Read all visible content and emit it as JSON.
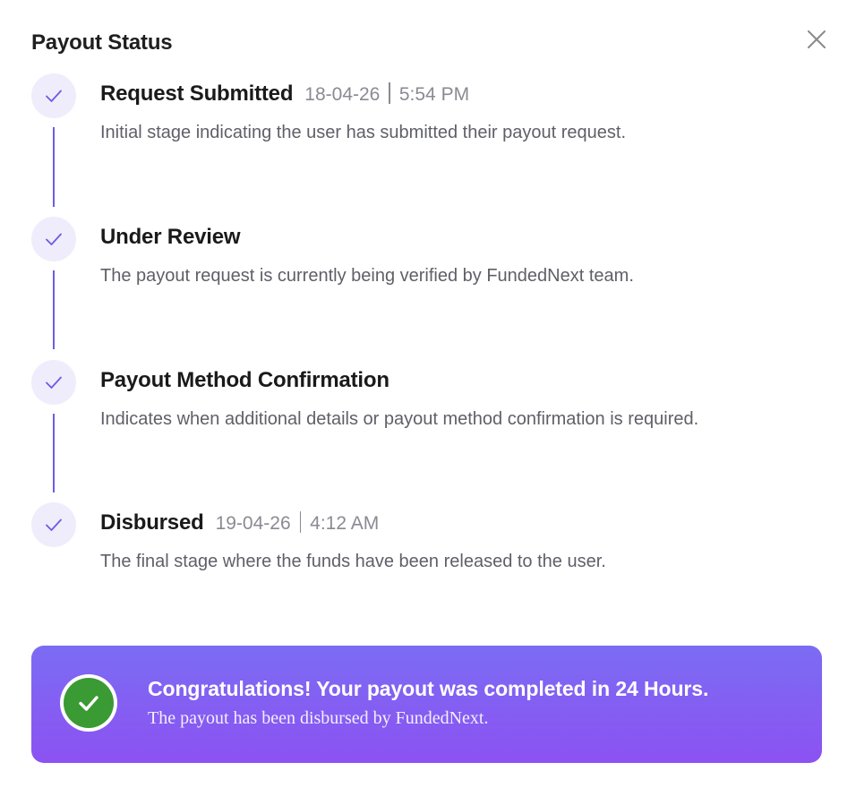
{
  "modal": {
    "title": "Payout Status",
    "close_icon": "close-icon"
  },
  "steps": [
    {
      "name": "Request Submitted",
      "date": "18-04-26",
      "time": "5:54 PM",
      "description": "Initial stage indicating the user has submitted their payout request.",
      "status": "completed",
      "icon": "check-icon"
    },
    {
      "name": "Under Review",
      "date": "",
      "time": "",
      "description": "The payout request is currently being verified by FundedNext team.",
      "status": "completed",
      "icon": "check-icon"
    },
    {
      "name": "Payout Method Confirmation",
      "date": "",
      "time": "",
      "description": "Indicates when additional details or payout method confirmation is required.",
      "status": "completed",
      "icon": "check-icon"
    },
    {
      "name": "Disbursed",
      "date": "19-04-26",
      "time": "4:12 AM",
      "description": "The final stage where the funds have been released to the user.",
      "status": "completed",
      "icon": "check-icon"
    }
  ],
  "banner": {
    "headline": "Congratulations! Your payout was completed in 24 Hours.",
    "subtext": "The payout has been disbursed by FundedNext.",
    "icon": "check-circle-icon"
  },
  "colors": {
    "accent": "#6b5ce7",
    "step_dot_bg": "#efedfb",
    "banner_gradient_top": "#7b6cf3",
    "banner_gradient_bottom": "#8c52f2",
    "success_green": "#3a9a33"
  }
}
